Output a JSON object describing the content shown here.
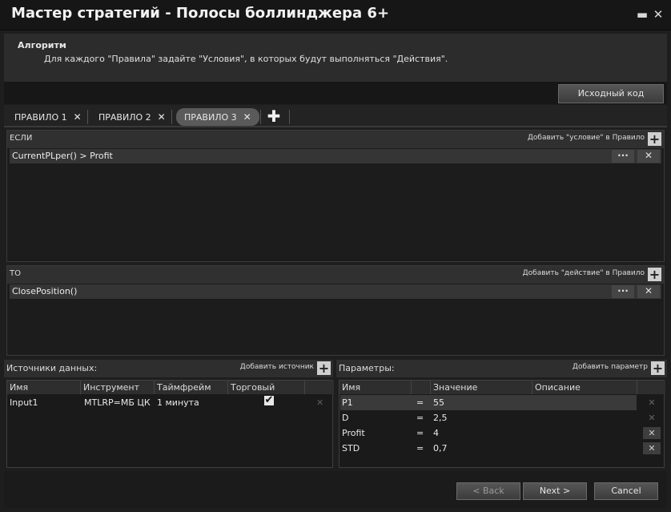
{
  "window": {
    "title": "Мастер стратегий - Полосы боллинджера 6+",
    "minimize": "▬",
    "close": "✕"
  },
  "algorithm": {
    "title": "Алгоритм",
    "description": "Для каждого \"Правила\" задайте \"Условия\", в которых будут выполняться \"Действия\"."
  },
  "source_code_button": "Исходный код",
  "tabs": [
    {
      "label": "ПРАВИЛО 1",
      "close": "✕"
    },
    {
      "label": "ПРАВИЛО 2",
      "close": "✕"
    },
    {
      "label": "ПРАВИЛО 3",
      "close": "✕"
    }
  ],
  "add_tab": "✚",
  "if_section": {
    "label": "ЕСЛИ",
    "add_label": "Добавить \"условие\" в Правило",
    "rows": [
      "CurrentPLper() > Profit"
    ]
  },
  "then_section": {
    "label": "ТО",
    "add_label": "Добавить \"действие\" в Правило",
    "rows": [
      "ClosePosition()"
    ]
  },
  "row_menu": "···",
  "row_delete": "✕",
  "plus": "+",
  "data_sources": {
    "label": "Источники данных:",
    "add_label": "Добавить источник",
    "columns": [
      "Имя",
      "Инструмент",
      "Таймфрейм",
      "Торговый"
    ],
    "rows": [
      {
        "name": "Input1",
        "instrument": "MTLRP=МБ ЦК",
        "timeframe": "1 минута",
        "trading": "✔",
        "delete": "✕"
      }
    ]
  },
  "parameters": {
    "label": "Параметры:",
    "add_label": "Добавить параметр",
    "columns": [
      "Имя",
      "Значение",
      "Описание"
    ],
    "rows": [
      {
        "name": "P1",
        "eq": "=",
        "value": "55",
        "delete": "✕"
      },
      {
        "name": "D",
        "eq": "=",
        "value": "2,5",
        "delete": "✕"
      },
      {
        "name": "Profit",
        "eq": "=",
        "value": "4",
        "delete": "✕"
      },
      {
        "name": "STD",
        "eq": "=",
        "value": "0,7",
        "delete": "✕"
      }
    ]
  },
  "footer": {
    "back": "< Back",
    "next": "Next >",
    "cancel": "Cancel"
  }
}
